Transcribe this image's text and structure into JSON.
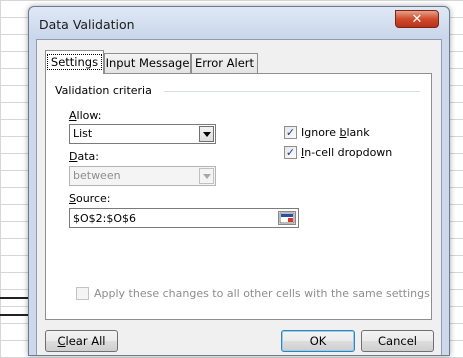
{
  "window": {
    "title": "Data Validation",
    "help_label": "?",
    "close_label": "✕"
  },
  "tabs": [
    {
      "label": "Settings",
      "active": true
    },
    {
      "label": "Input Message",
      "active": false
    },
    {
      "label": "Error Alert",
      "active": false
    }
  ],
  "settings": {
    "group_label": "Validation criteria",
    "allow": {
      "label_pre": "",
      "label_u": "A",
      "label_post": "llow:",
      "value": "List"
    },
    "data": {
      "label_pre": "",
      "label_u": "D",
      "label_post": "ata:",
      "value": "between"
    },
    "source": {
      "label_pre": "",
      "label_u": "S",
      "label_post": "ource:",
      "value": "$O$2:$O$6"
    },
    "ignore_blank": {
      "label_pre": "Ignore ",
      "label_u": "b",
      "label_post": "lank",
      "checked": true
    },
    "in_cell_dropdown": {
      "label_pre": "",
      "label_u": "I",
      "label_post": "n-cell dropdown",
      "checked": true
    },
    "apply_all": {
      "label_pre": "Apply these changes to all other cells with the same settings",
      "checked": false
    }
  },
  "buttons": {
    "clear_all_pre": "",
    "clear_all_u": "C",
    "clear_all_post": "lear All",
    "ok": "OK",
    "cancel": "Cancel"
  },
  "colors": {
    "check": "#21399a",
    "window_frame": "#cdd9ea",
    "close_red": "#cf4b2c"
  }
}
